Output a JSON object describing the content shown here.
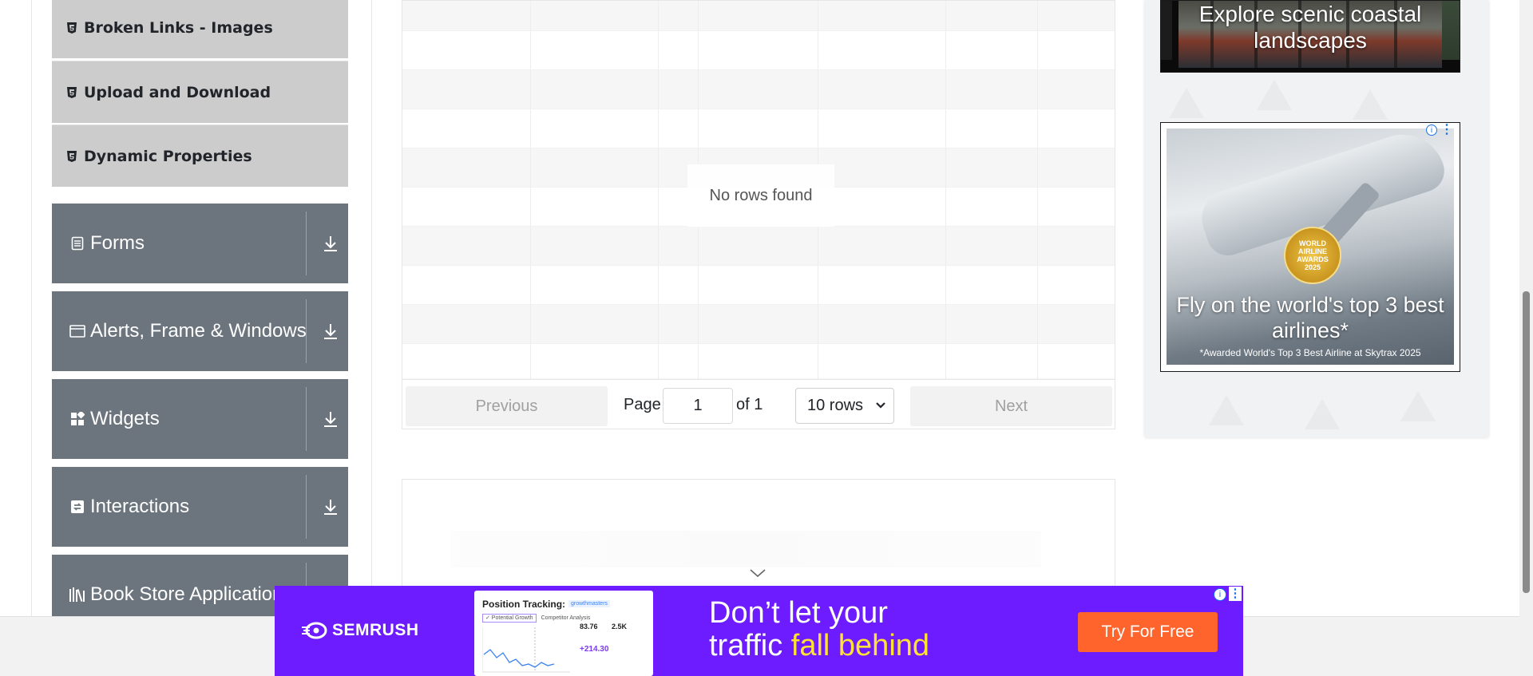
{
  "sidebar": {
    "sub_items": [
      {
        "label": "Broken Links - Images",
        "icon": "html5-icon"
      },
      {
        "label": "Upload and Download",
        "icon": "html5-icon"
      },
      {
        "label": "Dynamic Properties",
        "icon": "html5-icon"
      }
    ],
    "groups": [
      {
        "label": "Forms",
        "icon": "document-icon"
      },
      {
        "label": "Alerts, Frame & Windows",
        "icon": "window-icon"
      },
      {
        "label": "Widgets",
        "icon": "widgets-icon"
      },
      {
        "label": "Interactions",
        "icon": "interactions-icon"
      },
      {
        "label": "Book Store Application",
        "icon": "books-icon"
      }
    ]
  },
  "table": {
    "empty_message": "No rows found",
    "pagination": {
      "previous_label": "Previous",
      "next_label": "Next",
      "page_label": "Page",
      "current_page": "1",
      "of_label": "of 1",
      "rows_option": "10 rows"
    }
  },
  "ads": {
    "ad1_text": "Explore scenic coastal landscapes",
    "ad2_title": "Fly on the world's top 3 best airlines*",
    "ad2_subtitle": "*Awarded World's Top 3 Best Airline at Skytrax 2025",
    "ad2_badge": "WORLD AIRLINE AWARDS 2025",
    "semrush": {
      "brand": "SEMRUSH",
      "screenshot_title": "Position Tracking:",
      "screenshot_tag": "growthmasters",
      "screenshot_tab1": "✓ Potential Growth",
      "screenshot_tab2": "Competitor Analysis",
      "metric1": "83.76",
      "metric2": "2.5K",
      "growth": "+214.30",
      "headline_line1": "Don’t let your",
      "headline_line2_a": "traffic ",
      "headline_line2_b": "fall behind",
      "cta": "Try For Free"
    }
  },
  "colors": {
    "sidebar_group_bg": "#6c757d",
    "sidebar_sub_bg": "#cccccc",
    "semrush_bg": "#6d1bff",
    "semrush_cta": "#ff642d",
    "semrush_highlight": "#ffe234"
  }
}
